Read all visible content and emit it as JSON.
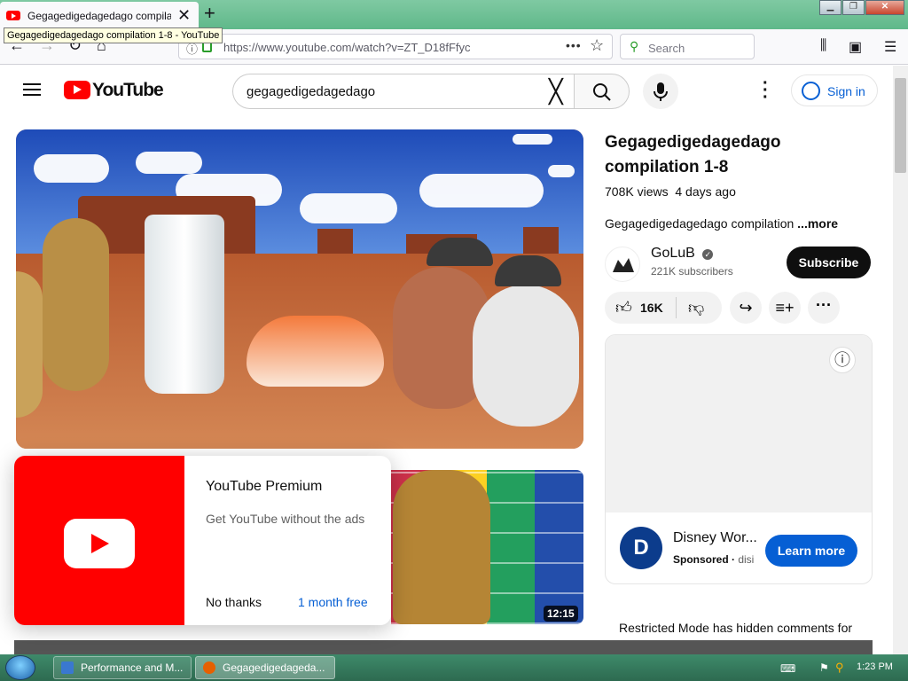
{
  "browser": {
    "tab_title": "Gegagedigedagedago compilati",
    "tooltip": "Gegagedigedagedago compilation 1-8 - YouTube",
    "url": "https://www.youtube.com/watch?v=ZT_D18fFfyc",
    "search_placeholder": "Search"
  },
  "youtube": {
    "logo_text": "YouTube",
    "search_query": "gegagedigedagedago",
    "sign_in": "Sign in"
  },
  "video": {
    "title": "Gegagedigedagedago compilation 1-8",
    "views": "708K views",
    "age": "4 days ago",
    "description": "Gegagedigedagedago compilation",
    "more": "...more",
    "channel": "GoLuB",
    "subscribers": "221K subscribers",
    "subscribe": "Subscribe",
    "likes": "16K"
  },
  "ad": {
    "title": "Disney World",
    "title_shown": "Disney Wor...",
    "sponsored": "Sponsored",
    "domain": "disi",
    "cta": "Learn more"
  },
  "premium_popup": {
    "title": "YouTube Premium",
    "subtitle": "Get YouTube without the ads",
    "dismiss": "No thanks",
    "accept": "1 month free"
  },
  "next_video": {
    "duration": "12:15"
  },
  "comments_notice": "Restricted Mode has hidden comments for",
  "taskbar": {
    "items": [
      "Performance and M...",
      "Gegagedigedageda..."
    ],
    "time": "1:23 PM"
  },
  "colors": {
    "youtube_red": "#ff0000",
    "link_blue": "#065fd4",
    "titlebar_green": "#6cc097"
  }
}
